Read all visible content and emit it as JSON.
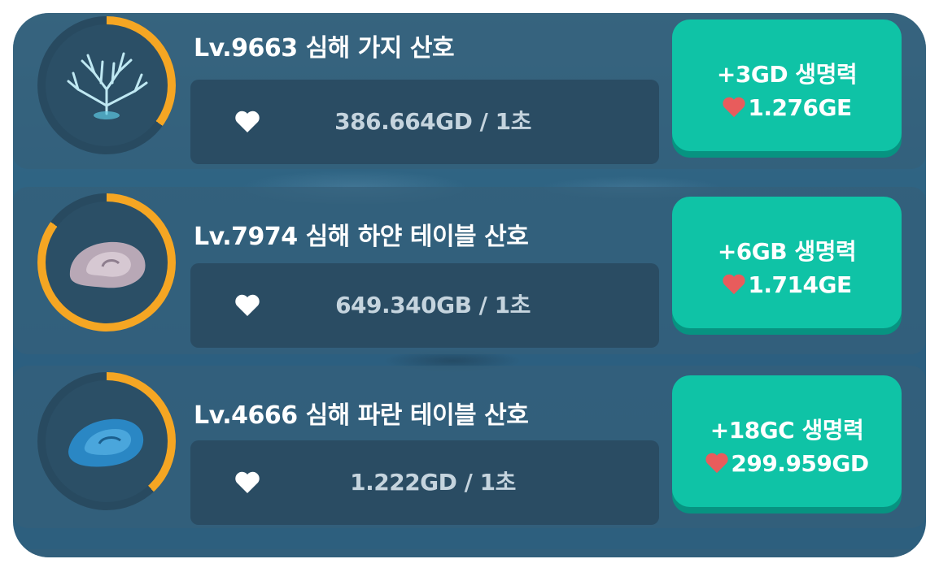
{
  "colors": {
    "ring_progress": "#f5a623",
    "button_bg": "#0fc3a6",
    "heart_white": "#ffffff",
    "heart_red": "#e85c5c"
  },
  "items": [
    {
      "title": "Lv.9663 심해 가지 산호",
      "rate": "386.664GD / 1초",
      "buy_line1": "+3GD 생명력",
      "buy_cost": "1.276GE",
      "progress": 0.35,
      "icon": "branch-coral-icon"
    },
    {
      "title": "Lv.7974 심해 하얀 테이블 산호",
      "rate": "649.340GB / 1초",
      "buy_line1": "+6GB 생명력",
      "buy_cost": "1.714GE",
      "progress": 0.85,
      "icon": "white-table-coral-icon"
    },
    {
      "title": "Lv.4666 심해 파란 테이블 산호",
      "rate": "1.222GD / 1초",
      "buy_line1": "+18GC 생명력",
      "buy_cost": "299.959GD",
      "progress": 0.38,
      "icon": "blue-table-coral-icon"
    }
  ]
}
